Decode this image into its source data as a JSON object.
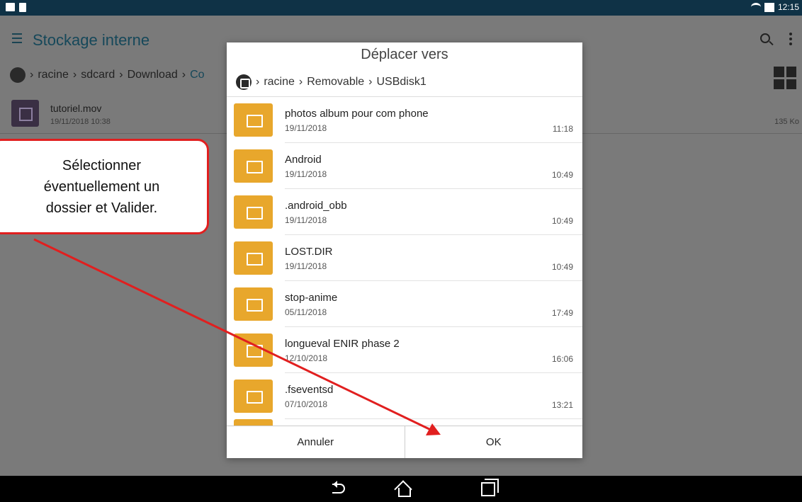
{
  "status_bar": {
    "time": "12:15",
    "icons": [
      "photo-icon",
      "file-icon",
      "wifi-icon",
      "battery-icon"
    ]
  },
  "app": {
    "title": "Stockage interne",
    "breadcrumb": [
      "racine",
      "sdcard",
      "Download",
      "Co"
    ],
    "file": {
      "name": "tutoriel.mov",
      "date": "19/11/2018  10:38",
      "size": "135 Ko"
    }
  },
  "dialog": {
    "title": "Déplacer vers",
    "breadcrumb": [
      "racine",
      "Removable",
      "USBdisk1"
    ],
    "folders": [
      {
        "name": "photos album pour com phone",
        "date": "19/11/2018",
        "time": "11:18"
      },
      {
        "name": "Android",
        "date": "19/11/2018",
        "time": "10:49"
      },
      {
        "name": ".android_obb",
        "date": "19/11/2018",
        "time": "10:49"
      },
      {
        "name": "LOST.DIR",
        "date": "19/11/2018",
        "time": "10:49"
      },
      {
        "name": "stop-anime",
        "date": "05/11/2018",
        "time": "17:49"
      },
      {
        "name": "longueval ENIR phase 2",
        "date": "12/10/2018",
        "time": "16:06"
      },
      {
        "name": ".fseventsd",
        "date": "07/10/2018",
        "time": "13:21"
      }
    ],
    "cancel_label": "Annuler",
    "ok_label": "OK"
  },
  "annotation": {
    "text": "Sélectionner\néventuellement un\ndossier et Valider.",
    "color": "#e11f1f"
  },
  "colors": {
    "accent": "#16485a",
    "folder": "#e8a72c"
  }
}
